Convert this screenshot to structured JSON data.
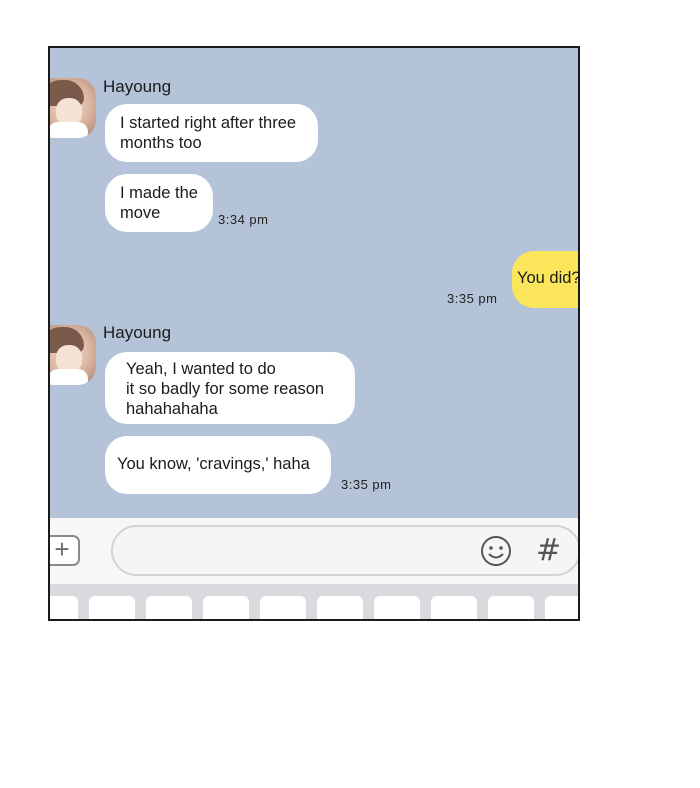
{
  "messages": [
    {
      "sender": "Hayoung",
      "lines": [
        "I started right after three\nmonths too",
        "I made the\nmove"
      ],
      "time": "3:34 pm"
    },
    {
      "sender": "me",
      "text": "You did?",
      "time": "3:35 pm"
    },
    {
      "sender": "Hayoung",
      "lines": [
        "Yeah, I wanted to do\nit so badly  for some reason\nhahahahaha",
        "You know, 'cravings,' haha"
      ],
      "time": "3:35 pm"
    }
  ],
  "input": {
    "plus_label": "+",
    "hash_label": "#",
    "placeholder": ""
  },
  "colors": {
    "chat_bg": "#b4c3d7",
    "my_bubble": "#fbe55b",
    "their_bubble": "#ffffff"
  }
}
